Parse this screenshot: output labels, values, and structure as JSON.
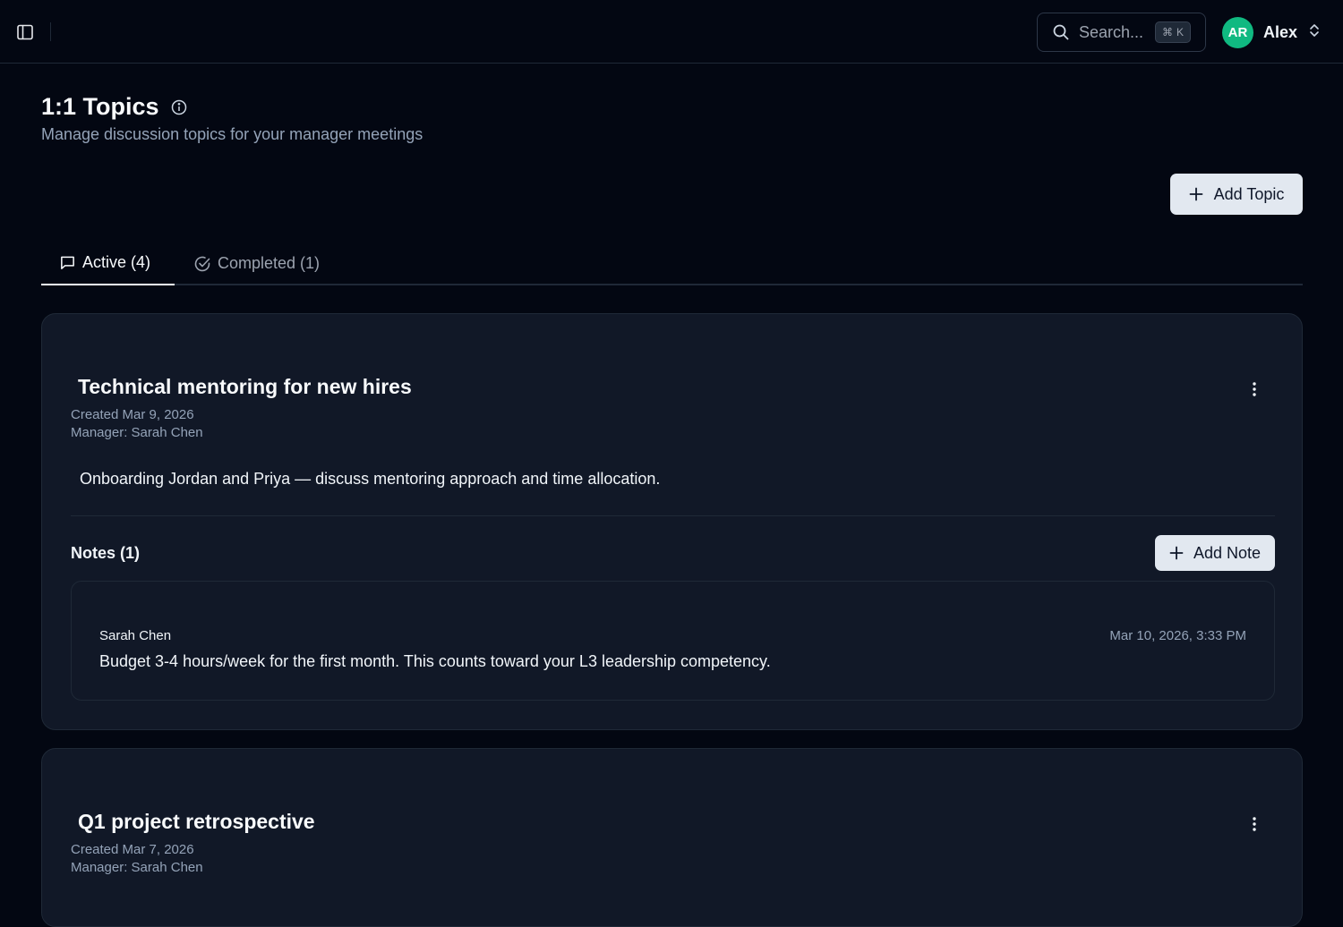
{
  "header": {
    "search_placeholder": "Search...",
    "search_shortcut_symbol": "⌘",
    "search_shortcut_key": "K",
    "user_initials": "AR",
    "user_name": "Alex"
  },
  "page": {
    "title": "1:1 Topics",
    "subtitle": "Manage discussion topics for your manager meetings",
    "add_topic_label": "Add Topic"
  },
  "tabs": [
    {
      "label": "Active (4)",
      "active": true
    },
    {
      "label": "Completed (1)",
      "active": false
    }
  ],
  "topics": [
    {
      "title": "Technical mentoring for new hires",
      "created": "Created Mar 9, 2026",
      "manager": "Manager: Sarah Chen",
      "description": "Onboarding Jordan and Priya — discuss mentoring approach and time allocation.",
      "notes_label": "Notes (1)",
      "add_note_label": "Add Note",
      "notes": [
        {
          "author": "Sarah Chen",
          "timestamp": "Mar 10, 2026, 3:33 PM",
          "body": "Budget 3-4 hours/week for the first month. This counts toward your L3 leadership competency."
        }
      ]
    },
    {
      "title": "Q1 project retrospective",
      "created": "Created Mar 7, 2026",
      "manager": "Manager: Sarah Chen"
    }
  ],
  "colors": {
    "background": "#030712",
    "card": "#111827",
    "border": "#1f2937",
    "avatar": "#10b981",
    "button": "#e2e8f0",
    "muted_text": "#94a3b8"
  }
}
